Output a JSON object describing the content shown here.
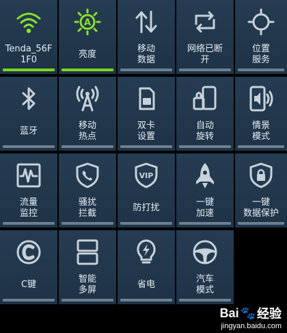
{
  "tiles": [
    {
      "id": "wifi",
      "label1": "Tenda_56F",
      "label2": "1F0",
      "icon": "wifi-icon",
      "active": true
    },
    {
      "id": "brightness",
      "label1": "亮度",
      "label2": "",
      "icon": "brightness-auto-icon",
      "icon_text": "A",
      "active": true
    },
    {
      "id": "mobile-data",
      "label1": "移动",
      "label2": "数据",
      "icon": "up-down-arrows-icon",
      "active": false
    },
    {
      "id": "network-disconnect",
      "label1": "网络已断",
      "label2": "开",
      "icon": "sync-arrows-icon",
      "active": false
    },
    {
      "id": "location",
      "label1": "位置",
      "label2": "服务",
      "icon": "location-crosshair-icon",
      "active": false
    },
    {
      "id": "bluetooth",
      "label1": "蓝牙",
      "label2": "",
      "icon": "bluetooth-icon",
      "active": false
    },
    {
      "id": "hotspot",
      "label1": "移动",
      "label2": "热点",
      "icon": "hotspot-antenna-icon",
      "active": false
    },
    {
      "id": "dual-sim",
      "label1": "双卡",
      "label2": "设置",
      "icon": "sim-card-icon",
      "active": false
    },
    {
      "id": "auto-rotate",
      "label1": "自动",
      "label2": "旋转",
      "icon": "rotate-lock-icon",
      "active": false
    },
    {
      "id": "scene-mode",
      "label1": "情景",
      "label2": "模式",
      "icon": "phone-sound-icon",
      "active": false
    },
    {
      "id": "traffic-monitor",
      "label1": "流量",
      "label2": "监控",
      "icon": "traffic-graph-icon",
      "active": false
    },
    {
      "id": "harassment-block",
      "label1": "骚扰",
      "label2": "拦截",
      "icon": "shield-phone-icon",
      "active": false
    },
    {
      "id": "anti-harass",
      "label1": "防打扰",
      "label2": "",
      "icon": "vip-shield-icon",
      "icon_text": "VIP",
      "active": false
    },
    {
      "id": "one-key-boost",
      "label1": "一键",
      "label2": "加速",
      "icon": "rocket-icon",
      "active": false
    },
    {
      "id": "data-protect",
      "label1": "一键",
      "label2": "数据保护",
      "icon": "shield-lock-icon",
      "active": false
    },
    {
      "id": "c-key",
      "label1": "C键",
      "label2": "",
      "icon": "c-key-icon",
      "icon_text": "C",
      "active": false
    },
    {
      "id": "smart-multiscreen",
      "label1": "智能",
      "label2": "多屏",
      "icon": "split-screen-icon",
      "active": false
    },
    {
      "id": "power-save",
      "label1": "省电",
      "label2": "",
      "icon": "bulb-bolt-icon",
      "active": false
    },
    {
      "id": "car-mode",
      "label1": "汽车",
      "label2": "模式",
      "icon": "steering-wheel-icon",
      "active": false
    }
  ],
  "watermark": {
    "logo_text": "Bai",
    "logo_text2": "经验",
    "url": "jingyan.baidu.com",
    "paw": "🐾"
  },
  "colors": {
    "tile_bg": "#223a50",
    "active_accent": "#7ad61e",
    "inactive_bar": "#6e7f8d",
    "icon_gray": "#c8d2da"
  }
}
